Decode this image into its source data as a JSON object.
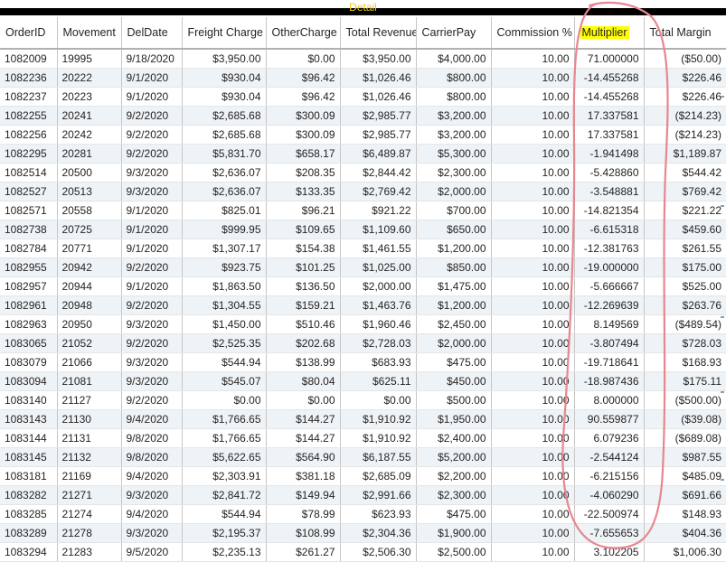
{
  "visual": {
    "title": "Detail"
  },
  "table": {
    "columns": [
      "OrderID",
      "Movement",
      "DelDate",
      "Freight Charge",
      "OtherCharge",
      "Total Revenue",
      "CarrierPay",
      "Commission %",
      "Multiplier",
      "Total Margin"
    ],
    "highlighted_column": "Multiplier",
    "rows": [
      [
        "1082009",
        "19995",
        "9/18/2020",
        "$3,950.00",
        "$0.00",
        "$3,950.00",
        "$4,000.00",
        "10.00",
        "71.000000",
        "($50.00)"
      ],
      [
        "1082236",
        "20222",
        "9/1/2020",
        "$930.04",
        "$96.42",
        "$1,026.46",
        "$800.00",
        "10.00",
        "-14.455268",
        "$226.46"
      ],
      [
        "1082237",
        "20223",
        "9/1/2020",
        "$930.04",
        "$96.42",
        "$1,026.46",
        "$800.00",
        "10.00",
        "-14.455268",
        "$226.46"
      ],
      [
        "1082255",
        "20241",
        "9/2/2020",
        "$2,685.68",
        "$300.09",
        "$2,985.77",
        "$3,200.00",
        "10.00",
        "17.337581",
        "($214.23)"
      ],
      [
        "1082256",
        "20242",
        "9/2/2020",
        "$2,685.68",
        "$300.09",
        "$2,985.77",
        "$3,200.00",
        "10.00",
        "17.337581",
        "($214.23)"
      ],
      [
        "1082295",
        "20281",
        "9/2/2020",
        "$5,831.70",
        "$658.17",
        "$6,489.87",
        "$5,300.00",
        "10.00",
        "-1.941498",
        "$1,189.87"
      ],
      [
        "1082514",
        "20500",
        "9/3/2020",
        "$2,636.07",
        "$208.35",
        "$2,844.42",
        "$2,300.00",
        "10.00",
        "-5.428860",
        "$544.42"
      ],
      [
        "1082527",
        "20513",
        "9/3/2020",
        "$2,636.07",
        "$133.35",
        "$2,769.42",
        "$2,000.00",
        "10.00",
        "-3.548881",
        "$769.42"
      ],
      [
        "1082571",
        "20558",
        "9/1/2020",
        "$825.01",
        "$96.21",
        "$921.22",
        "$700.00",
        "10.00",
        "-14.821354",
        "$221.22"
      ],
      [
        "1082738",
        "20725",
        "9/1/2020",
        "$999.95",
        "$109.65",
        "$1,109.60",
        "$650.00",
        "10.00",
        "-6.615318",
        "$459.60"
      ],
      [
        "1082784",
        "20771",
        "9/1/2020",
        "$1,307.17",
        "$154.38",
        "$1,461.55",
        "$1,200.00",
        "10.00",
        "-12.381763",
        "$261.55"
      ],
      [
        "1082955",
        "20942",
        "9/2/2020",
        "$923.75",
        "$101.25",
        "$1,025.00",
        "$850.00",
        "10.00",
        "-19.000000",
        "$175.00"
      ],
      [
        "1082957",
        "20944",
        "9/1/2020",
        "$1,863.50",
        "$136.50",
        "$2,000.00",
        "$1,475.00",
        "10.00",
        "-5.666667",
        "$525.00"
      ],
      [
        "1082961",
        "20948",
        "9/2/2020",
        "$1,304.55",
        "$159.21",
        "$1,463.76",
        "$1,200.00",
        "10.00",
        "-12.269639",
        "$263.76"
      ],
      [
        "1082963",
        "20950",
        "9/3/2020",
        "$1,450.00",
        "$510.46",
        "$1,960.46",
        "$2,450.00",
        "10.00",
        "8.149569",
        "($489.54)"
      ],
      [
        "1083065",
        "21052",
        "9/2/2020",
        "$2,525.35",
        "$202.68",
        "$2,728.03",
        "$2,000.00",
        "10.00",
        "-3.807494",
        "$728.03"
      ],
      [
        "1083079",
        "21066",
        "9/3/2020",
        "$544.94",
        "$138.99",
        "$683.93",
        "$475.00",
        "10.00",
        "-19.718641",
        "$168.93"
      ],
      [
        "1083094",
        "21081",
        "9/3/2020",
        "$545.07",
        "$80.04",
        "$625.11",
        "$450.00",
        "10.00",
        "-18.987436",
        "$175.11"
      ],
      [
        "1083140",
        "21127",
        "9/2/2020",
        "$0.00",
        "$0.00",
        "$0.00",
        "$500.00",
        "10.00",
        "8.000000",
        "($500.00)"
      ],
      [
        "1083143",
        "21130",
        "9/4/2020",
        "$1,766.65",
        "$144.27",
        "$1,910.92",
        "$1,950.00",
        "10.00",
        "90.559877",
        "($39.08)"
      ],
      [
        "1083144",
        "21131",
        "9/8/2020",
        "$1,766.65",
        "$144.27",
        "$1,910.92",
        "$2,400.00",
        "10.00",
        "6.079236",
        "($689.08)"
      ],
      [
        "1083145",
        "21132",
        "9/8/2020",
        "$5,622.65",
        "$564.90",
        "$6,187.55",
        "$5,200.00",
        "10.00",
        "-2.544124",
        "$987.55"
      ],
      [
        "1083181",
        "21169",
        "9/4/2020",
        "$2,303.91",
        "$381.18",
        "$2,685.09",
        "$2,200.00",
        "10.00",
        "-6.215156",
        "$485.09"
      ],
      [
        "1083282",
        "21271",
        "9/3/2020",
        "$2,841.72",
        "$149.94",
        "$2,991.66",
        "$2,300.00",
        "10.00",
        "-4.060290",
        "$691.66"
      ],
      [
        "1083285",
        "21274",
        "9/4/2020",
        "$544.94",
        "$78.99",
        "$623.93",
        "$475.00",
        "10.00",
        "-22.500974",
        "$148.93"
      ],
      [
        "1083289",
        "21278",
        "9/3/2020",
        "$2,195.37",
        "$108.99",
        "$2,304.36",
        "$1,900.00",
        "10.00",
        "-7.655653",
        "$404.36"
      ],
      [
        "1083294",
        "21283",
        "9/5/2020",
        "$2,235.13",
        "$261.27",
        "$2,506.30",
        "$2,500.00",
        "10.00",
        "3.102205",
        "$1,006.30"
      ]
    ]
  },
  "colors": {
    "title_text": "#f2c811",
    "title_band": "#000000",
    "highlight": "#ffff00",
    "annotation_stroke": "#e8868e",
    "alt_row": "#eef3f7"
  }
}
